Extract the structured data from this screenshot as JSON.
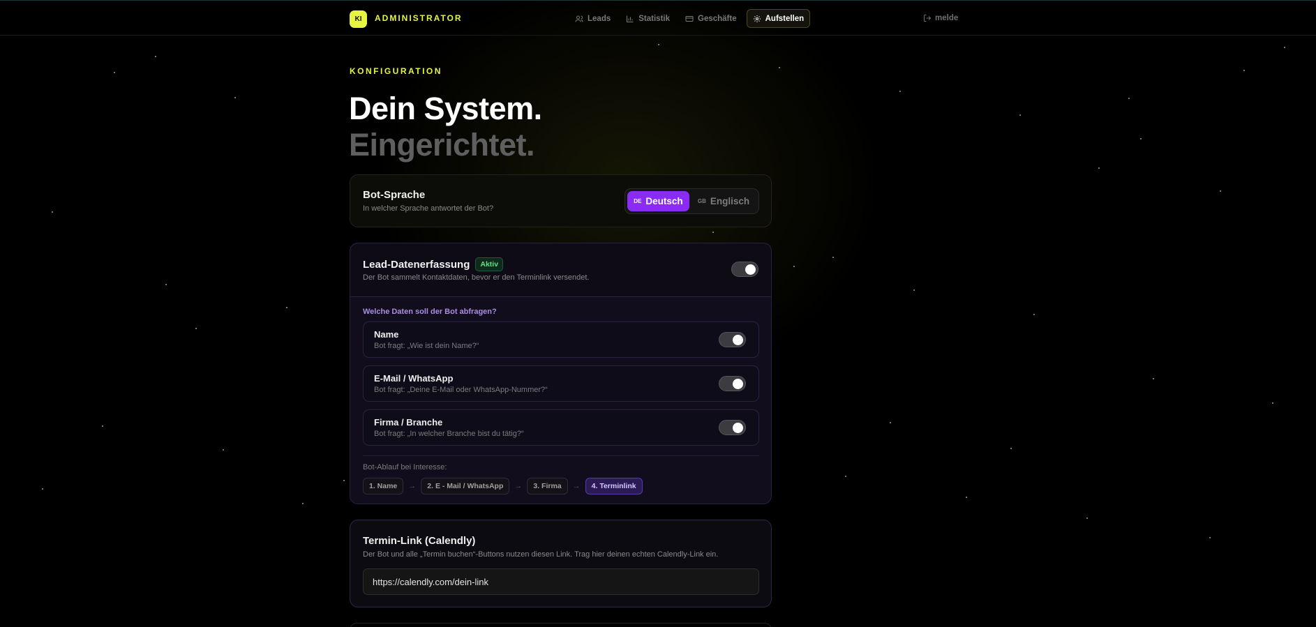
{
  "nav": {
    "logo_text": "KI",
    "brand": "ADMINISTRATOR",
    "links": [
      {
        "label": "Leads",
        "icon": "users-icon"
      },
      {
        "label": "Statistik",
        "icon": "bar-chart-icon"
      },
      {
        "label": "Geschäfte",
        "icon": "credit-card-icon"
      },
      {
        "label": "Aufstellen",
        "icon": "gear-icon",
        "active": true
      }
    ],
    "logout_label": "melde"
  },
  "header": {
    "eyebrow": "KONFIGURATION",
    "title_line1": "Dein System.",
    "title_line2": "Eingerichtet."
  },
  "language": {
    "title": "Bot-Sprache",
    "subtitle": "In welcher Sprache antwortet der Bot?",
    "options": [
      {
        "code": "DE",
        "label": "Deutsch",
        "selected": true
      },
      {
        "code": "GB",
        "label": "Englisch",
        "selected": false
      }
    ]
  },
  "lead": {
    "title": "Lead-Datenerfassung",
    "badge": "Aktiv",
    "subtitle": "Der Bot sammelt Kontaktdaten, bevor er den Terminlink versendet.",
    "enabled": true,
    "question": "Welche Daten soll der Bot abfragen?",
    "fields": [
      {
        "name": "Name",
        "prompt": "Bot fragt: „Wie ist dein Name?“",
        "enabled": true
      },
      {
        "name": "E-Mail / WhatsApp",
        "prompt": "Bot fragt: „Deine E-Mail oder WhatsApp-Nummer?“",
        "enabled": true
      },
      {
        "name": "Firma / Branche",
        "prompt": "Bot fragt: „In welcher Branche bist du tätig?“",
        "enabled": true
      }
    ],
    "flow_label": "Bot-Ablauf bei Interesse:",
    "flow_steps": [
      "1. Name",
      "2. E - Mail / WhatsApp",
      "3. Firma",
      "4. Terminlink"
    ],
    "flow_arrow": "→"
  },
  "calendly": {
    "title": "Termin-Link (Calendly)",
    "subtitle": "Der Bot und alle „Termin buchen“-Buttons nutzen diesen Link. Trag hier deinen echten Calendly-Link ein.",
    "value": "https://calendly.com/dein-link"
  },
  "colors": {
    "accent": "#e7f542",
    "purple": "#8b2cf5",
    "active_green": "#5fe08a"
  }
}
